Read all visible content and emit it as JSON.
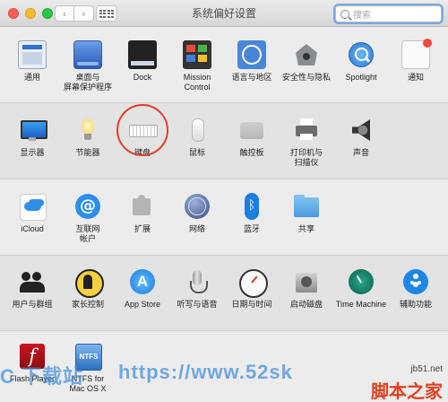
{
  "window": {
    "title": "系统偏好设置",
    "back_glyph": "‹",
    "forward_glyph": "›"
  },
  "search": {
    "placeholder": "搜索"
  },
  "sections": [
    {
      "items": [
        {
          "label": "通用",
          "icon": "general-icon"
        },
        {
          "label": "桌面与\n屏幕保护程序",
          "icon": "desktop-screensaver-icon"
        },
        {
          "label": "Dock",
          "icon": "dock-icon"
        },
        {
          "label": "Mission\nControl",
          "icon": "mission-control-icon"
        },
        {
          "label": "语言与地区",
          "icon": "language-region-icon"
        },
        {
          "label": "安全性与隐私",
          "icon": "security-privacy-icon"
        },
        {
          "label": "Spotlight",
          "icon": "spotlight-icon"
        },
        {
          "label": "通知",
          "icon": "notifications-icon"
        }
      ]
    },
    {
      "items": [
        {
          "label": "显示器",
          "icon": "displays-icon"
        },
        {
          "label": "节能器",
          "icon": "energy-saver-icon"
        },
        {
          "label": "键盘",
          "icon": "keyboard-icon",
          "highlighted": true
        },
        {
          "label": "鼠标",
          "icon": "mouse-icon"
        },
        {
          "label": "触控板",
          "icon": "trackpad-icon"
        },
        {
          "label": "打印机与\n扫描仪",
          "icon": "printer-scanner-icon"
        },
        {
          "label": "声音",
          "icon": "sound-icon"
        }
      ]
    },
    {
      "items": [
        {
          "label": "iCloud",
          "icon": "icloud-icon"
        },
        {
          "label": "互联网\n帐户",
          "icon": "internet-accounts-icon"
        },
        {
          "label": "扩展",
          "icon": "extensions-icon"
        },
        {
          "label": "网络",
          "icon": "network-icon"
        },
        {
          "label": "蓝牙",
          "icon": "bluetooth-icon"
        },
        {
          "label": "共享",
          "icon": "sharing-icon"
        }
      ]
    },
    {
      "items": [
        {
          "label": "用户与群组",
          "icon": "users-groups-icon"
        },
        {
          "label": "家长控制",
          "icon": "parental-controls-icon"
        },
        {
          "label": "App Store",
          "icon": "app-store-icon"
        },
        {
          "label": "听写与语音",
          "icon": "dictation-speech-icon"
        },
        {
          "label": "日期与时间",
          "icon": "date-time-icon"
        },
        {
          "label": "启动磁盘",
          "icon": "startup-disk-icon"
        },
        {
          "label": "Time Machine",
          "icon": "time-machine-icon"
        },
        {
          "label": "辅助功能",
          "icon": "accessibility-icon"
        }
      ]
    },
    {
      "items": [
        {
          "label": "Flash Player",
          "icon": "flash-player-icon"
        },
        {
          "label": "NTFS for\nMac OS X",
          "icon": "ntfs-icon"
        }
      ]
    }
  ],
  "watermark": {
    "left": "C 下载站",
    "url": "https://www.52sk",
    "site": "jb51.net",
    "cn": "脚本之家"
  },
  "colors": {
    "highlight_ring": "#e53b2b",
    "notification_badge": "#f0493e",
    "search_focus": "#7aa7e8"
  }
}
